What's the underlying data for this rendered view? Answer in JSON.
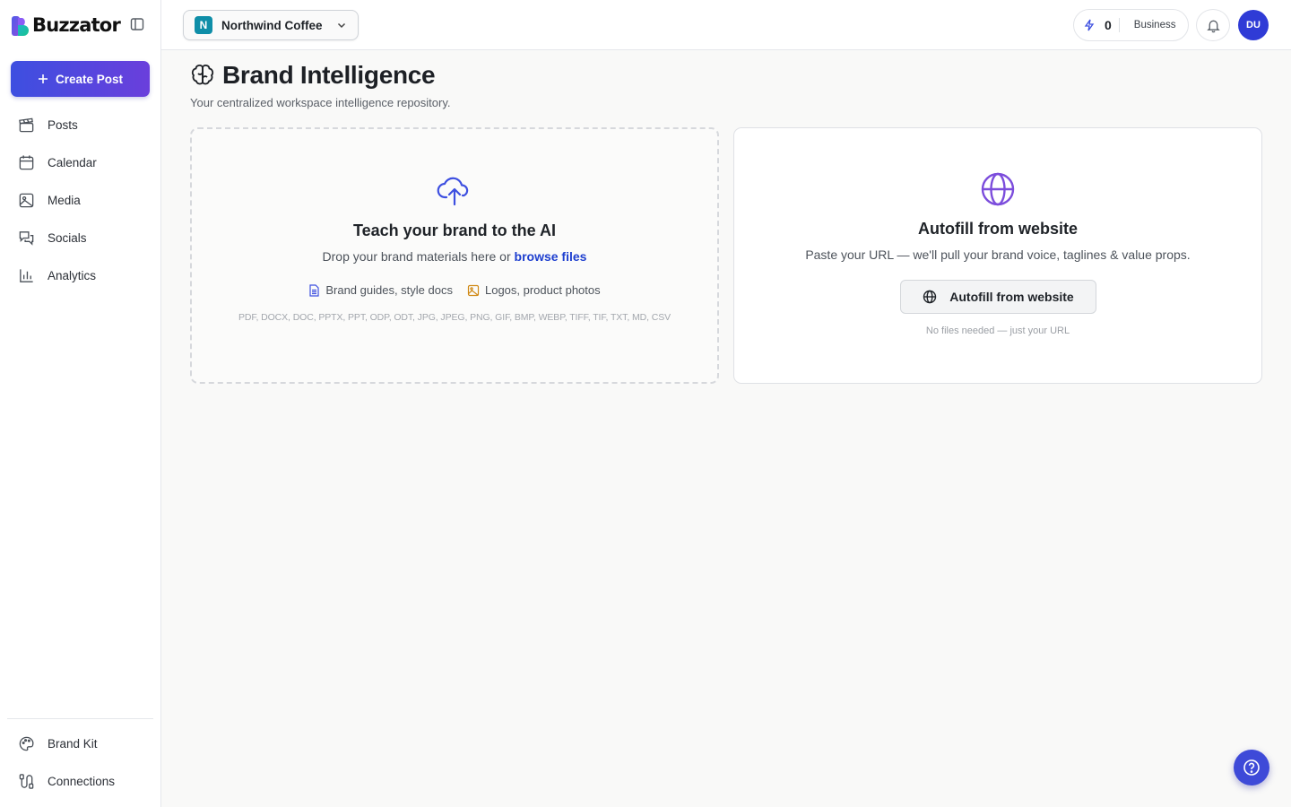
{
  "brand": {
    "name": "Buzzator"
  },
  "sidebar": {
    "create_label": "Create Post",
    "items": [
      {
        "label": "Posts",
        "icon": "clapperboard-icon"
      },
      {
        "label": "Calendar",
        "icon": "calendar-icon"
      },
      {
        "label": "Media",
        "icon": "image-icon"
      },
      {
        "label": "Socials",
        "icon": "chat-bubbles-icon"
      },
      {
        "label": "Analytics",
        "icon": "bar-chart-icon"
      }
    ],
    "bottom_items": [
      {
        "label": "Brand Kit",
        "icon": "palette-icon"
      },
      {
        "label": "Connections",
        "icon": "cable-icon"
      }
    ]
  },
  "topbar": {
    "workspace": {
      "initial": "N",
      "name": "Northwind Coffee"
    },
    "credits": "0",
    "plan": "Business",
    "user_initials": "DU"
  },
  "page": {
    "title": "Brand Intelligence",
    "subtitle": "Your centralized workspace intelligence repository."
  },
  "upload_card": {
    "title": "Teach your brand to the AI",
    "desc_prefix": "Drop your brand materials here or ",
    "browse_label": "browse files",
    "chip_docs": "Brand guides, style docs",
    "chip_images": "Logos, product photos",
    "formats": "PDF, DOCX, DOC, PPTX, PPT, ODP, ODT, JPG, JPEG, PNG, GIF, BMP, WEBP, TIFF, TIF, TXT, MD, CSV"
  },
  "website_card": {
    "title": "Autofill from website",
    "desc": "Paste your URL — we'll pull your brand voice, taglines & value props.",
    "button_label": "Autofill from website",
    "note": "No files needed — just your URL"
  },
  "colors": {
    "accent": "#3d4fe0",
    "accent_purple": "#7c4ddc",
    "avatar": "#2f3bd6",
    "workspace_badge": "#0f8ea8"
  }
}
